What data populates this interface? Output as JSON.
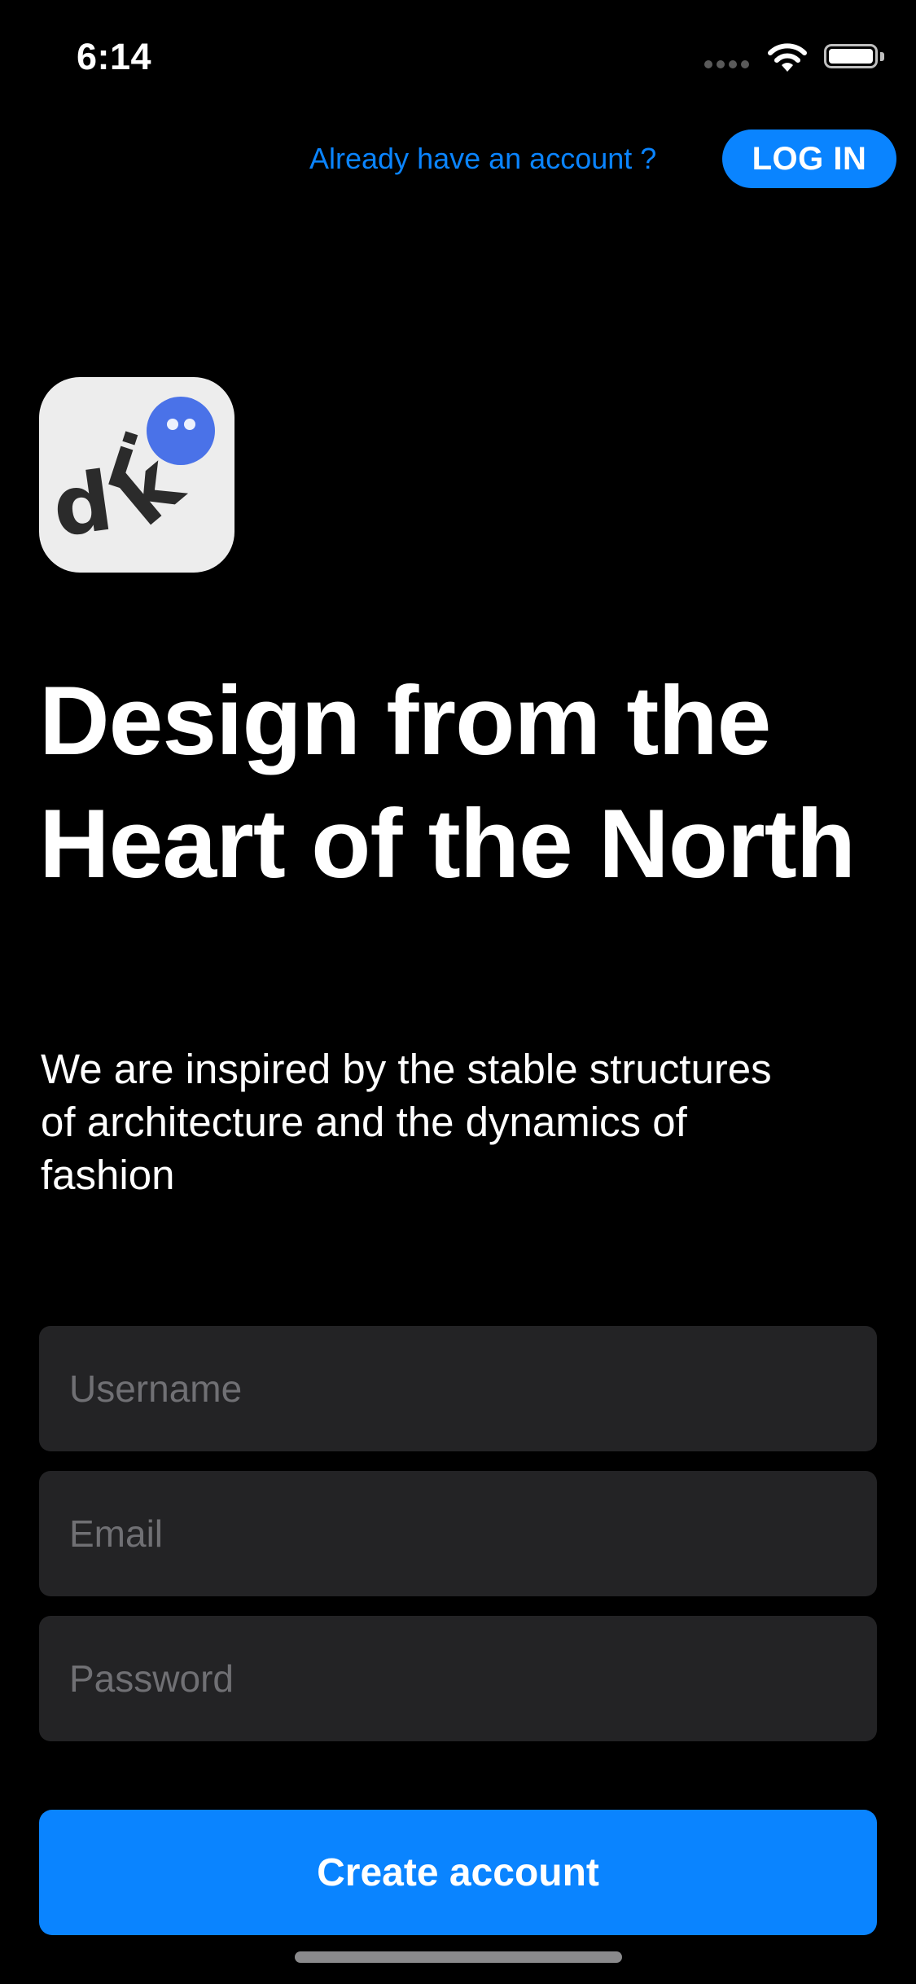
{
  "status_bar": {
    "time": "6:14"
  },
  "header": {
    "already_account_text": "Already have an account ?",
    "login_label": "LOG IN"
  },
  "logo": {
    "letters": [
      "d",
      "i",
      "k"
    ],
    "background_color": "#ededed",
    "accent_color": "#4a72e8"
  },
  "hero": {
    "title": "Design from the Heart of the North",
    "subtitle": "We are inspired by the stable structures of architecture and the dynamics of fashion"
  },
  "form": {
    "username_placeholder": "Username",
    "email_placeholder": "Email",
    "password_placeholder": "Password",
    "submit_label": "Create account"
  },
  "colors": {
    "background": "#000000",
    "accent": "#0a84ff",
    "field_background": "#232325",
    "placeholder": "#707074"
  }
}
